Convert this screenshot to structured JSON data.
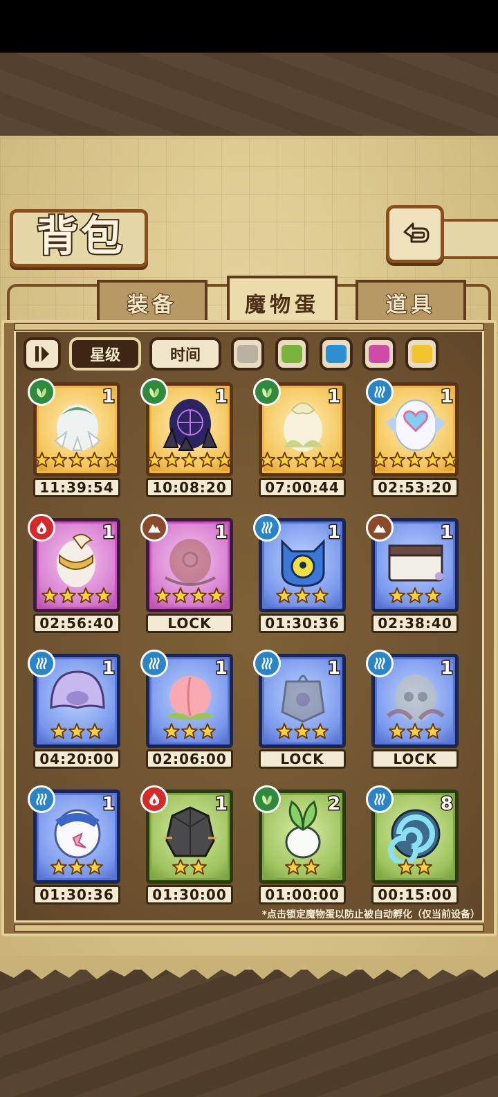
{
  "title": "背包",
  "tabs": [
    {
      "label": "装备",
      "active": false
    },
    {
      "label": "魔物蛋",
      "active": true
    },
    {
      "label": "道具",
      "active": false
    }
  ],
  "filters": {
    "sort_star": "星级",
    "sort_time": "时间",
    "color_swatches": [
      "#b9b2a0",
      "#7ab33a",
      "#2e8fd0",
      "#d04aa7",
      "#f2c52e"
    ]
  },
  "eggs": [
    {
      "element": "grass",
      "rarity": "gold",
      "count": "1",
      "stars": 5,
      "timer": "11:39:54",
      "art": "flower-egg",
      "locked": false
    },
    {
      "element": "grass",
      "rarity": "gold",
      "count": "1",
      "stars": 5,
      "timer": "10:08:20",
      "art": "dark-crystal-egg",
      "locked": false
    },
    {
      "element": "grass",
      "rarity": "gold",
      "count": "1",
      "stars": 5,
      "timer": "07:00:44",
      "art": "bud-egg",
      "locked": false
    },
    {
      "element": "water",
      "rarity": "gold",
      "count": "1",
      "stars": 5,
      "timer": "02:53:20",
      "art": "heart-egg",
      "locked": false
    },
    {
      "element": "fire",
      "rarity": "purple",
      "count": "1",
      "stars": 4,
      "timer": "02:56:40",
      "art": "golden-egg",
      "locked": false
    },
    {
      "element": "earth",
      "rarity": "purple",
      "count": "1",
      "stars": 4,
      "timer": "LOCK",
      "art": "thorn-egg",
      "locked": true
    },
    {
      "element": "water",
      "rarity": "blue",
      "count": "1",
      "stars": 3,
      "timer": "01:30:36",
      "art": "eye-egg",
      "locked": false
    },
    {
      "element": "earth",
      "rarity": "blue",
      "count": "1",
      "stars": 3,
      "timer": "02:38:40",
      "art": "book-egg",
      "locked": false
    },
    {
      "element": "water",
      "rarity": "blue",
      "count": "1",
      "stars": 3,
      "timer": "04:20:00",
      "art": "jelly-egg",
      "locked": false
    },
    {
      "element": "water",
      "rarity": "blue",
      "count": "1",
      "stars": 3,
      "timer": "02:06:00",
      "art": "peach-egg",
      "locked": false
    },
    {
      "element": "water",
      "rarity": "blue",
      "count": "1",
      "stars": 3,
      "timer": "LOCK",
      "art": "lantern-egg",
      "locked": true
    },
    {
      "element": "water",
      "rarity": "blue",
      "count": "1",
      "stars": 3,
      "timer": "LOCK",
      "art": "skull-egg",
      "locked": true
    },
    {
      "element": "water",
      "rarity": "blue",
      "count": "1",
      "stars": 3,
      "timer": "01:30:36",
      "art": "sailor-egg",
      "locked": false
    },
    {
      "element": "fire",
      "rarity": "green",
      "count": "1",
      "stars": 2,
      "timer": "01:30:00",
      "art": "rock-egg",
      "locked": false
    },
    {
      "element": "grass",
      "rarity": "green",
      "count": "2",
      "stars": 2,
      "timer": "01:00:00",
      "art": "radish-egg",
      "locked": false
    },
    {
      "element": "water",
      "rarity": "green",
      "count": "8",
      "stars": 2,
      "timer": "00:15:00",
      "art": "shell-egg",
      "locked": false
    }
  ],
  "hint": "*点击锁定魔物蛋以防止被自动孵化（仅当前设备）"
}
